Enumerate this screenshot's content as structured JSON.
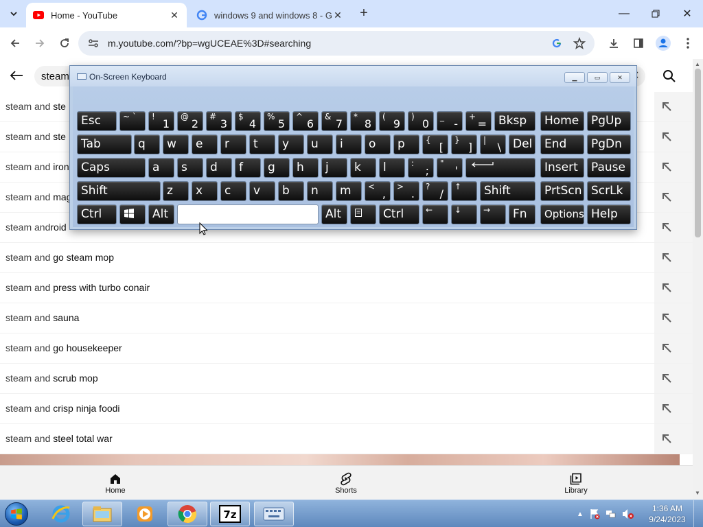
{
  "browser": {
    "tabs": [
      {
        "title": "Home - YouTube",
        "active": true
      },
      {
        "title": "windows 9 and windows 8 - G",
        "active": false
      }
    ],
    "url": "m.youtube.com/?bp=wgUCEAE%3D#searching"
  },
  "youtube": {
    "search_query": "steam",
    "suggestions": [
      {
        "prefix": "steam and ",
        "suffix": "ste"
      },
      {
        "prefix": "steam and ",
        "suffix": "ste"
      },
      {
        "prefix": "steam and ",
        "suffix": "iron"
      },
      {
        "prefix": "steam and ",
        "suffix": "mag"
      },
      {
        "prefix": "steam and",
        "suffix": "roid"
      },
      {
        "prefix": "steam and ",
        "suffix": "go steam mop"
      },
      {
        "prefix": "steam and ",
        "suffix": "press with turbo conair"
      },
      {
        "prefix": "steam and ",
        "suffix": "sauna"
      },
      {
        "prefix": "steam and ",
        "suffix": "go housekeeper"
      },
      {
        "prefix": "steam and ",
        "suffix": "scrub mop"
      },
      {
        "prefix": "steam and ",
        "suffix": "crisp ninja foodi"
      },
      {
        "prefix": "steam and ",
        "suffix": "steel total war"
      }
    ],
    "pivot_bar": {
      "home": "Home",
      "shorts": "Shorts",
      "library": "Library"
    }
  },
  "osk": {
    "title": "On-Screen Keyboard",
    "keys": {
      "esc": "Esc",
      "bksp": "Bksp",
      "home": "Home",
      "pgup": "PgUp",
      "tab": "Tab",
      "del": "Del",
      "end": "End",
      "pgdn": "PgDn",
      "caps": "Caps",
      "insert": "Insert",
      "pause": "Pause",
      "shift": "Shift",
      "prtscn": "PrtScn",
      "scrlk": "ScrLk",
      "ctrl": "Ctrl",
      "alt": "Alt",
      "fn": "Fn",
      "options": "Options",
      "help": "Help"
    },
    "letters_row1": [
      "q",
      "w",
      "e",
      "r",
      "t",
      "y",
      "u",
      "i",
      "o",
      "p"
    ],
    "letters_row2": [
      "a",
      "s",
      "d",
      "f",
      "g",
      "h",
      "j",
      "k",
      "l"
    ],
    "letters_row3": [
      "z",
      "x",
      "c",
      "v",
      "b",
      "n",
      "m"
    ]
  },
  "taskbar": {
    "time": "1:36 AM",
    "date": "9/24/2023",
    "apps": [
      "start-orb",
      "internet-explorer",
      "windows-explorer",
      "media-player",
      "chrome",
      "7-zip",
      "on-screen-keyboard"
    ]
  }
}
